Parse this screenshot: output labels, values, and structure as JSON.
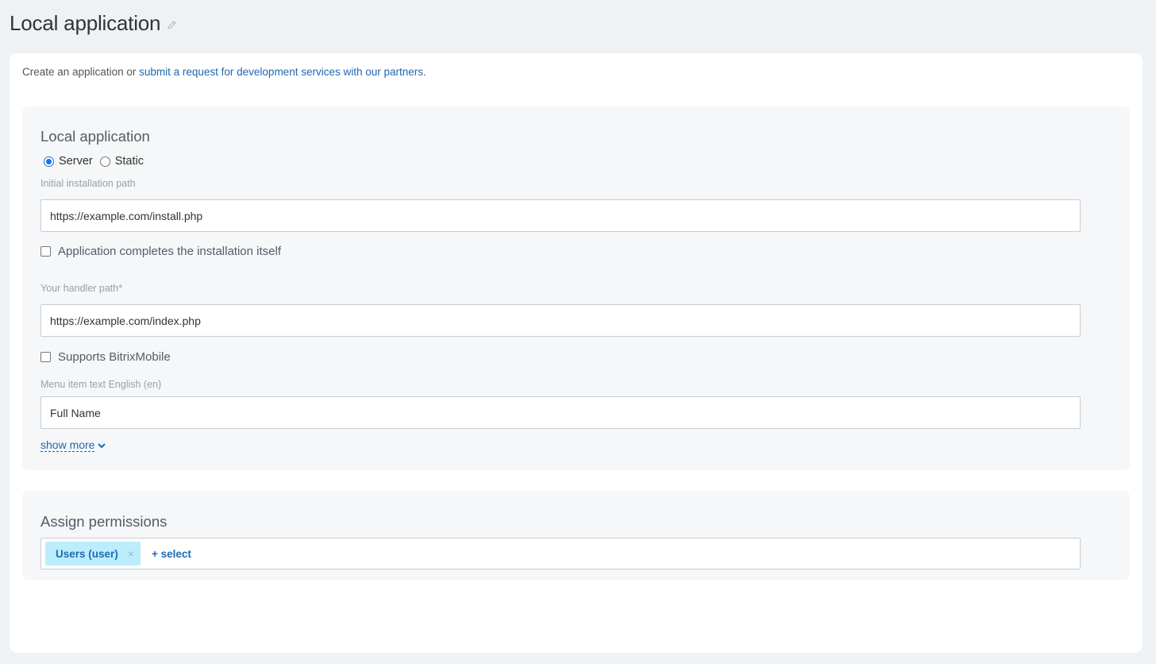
{
  "page": {
    "title": "Local application",
    "edit_icon": "pencil-icon"
  },
  "intro": {
    "text": "Create an application or ",
    "link": "submit a request for development services with our partners",
    "suffix": "."
  },
  "app_section": {
    "title": "Local application",
    "type_options": [
      {
        "label": "Server",
        "checked": true
      },
      {
        "label": "Static",
        "checked": false
      }
    ],
    "install_path": {
      "label": "Initial installation path",
      "value": "https://example.com/install.php"
    },
    "completes_install": {
      "label": "Application completes the installation itself",
      "checked": false
    },
    "handler_path": {
      "label": "Your handler path*",
      "value": "https://example.com/index.php"
    },
    "supports_mobile": {
      "label": "Supports BitrixMobile",
      "checked": false
    },
    "menu_item": {
      "label": "Menu item text English (en)",
      "value": "Full Name"
    },
    "show_more": "show more"
  },
  "permissions": {
    "title": "Assign permissions",
    "tags": [
      {
        "label": "Users (user)"
      }
    ],
    "remove_symbol": "×",
    "select_label": "+ select"
  },
  "colors": {
    "link": "#2067b0",
    "tag_bg": "#bcedfc",
    "radio_accent": "#1a73e8"
  }
}
